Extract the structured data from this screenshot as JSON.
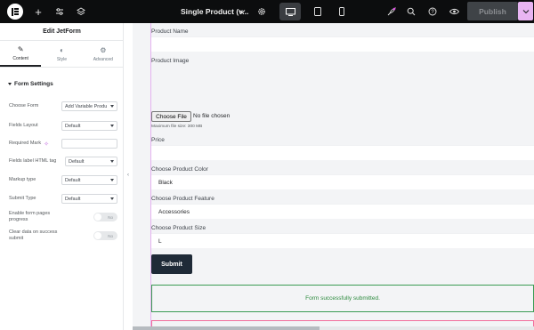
{
  "topbar": {
    "doc_title": "Single Product (v...",
    "publish_label": "Publish",
    "icons": [
      "elementor-logo",
      "plus-icon",
      "sliders-icon",
      "layers-icon",
      "chevron-down-icon",
      "gear-icon",
      "desktop-icon",
      "tablet-icon",
      "mobile-icon",
      "rocket-icon",
      "search-icon",
      "help-icon",
      "eye-icon",
      "chevron-down-icon"
    ]
  },
  "panel": {
    "title": "Edit JetForm",
    "tabs": [
      {
        "label": "Content",
        "icon": "pencil-icon",
        "active": true
      },
      {
        "label": "Style",
        "icon": "contrast-icon",
        "active": false
      },
      {
        "label": "Advanced",
        "icon": "gear-icon",
        "active": false
      }
    ],
    "section_title": "Form Settings",
    "controls": [
      {
        "label": "Choose Form",
        "value": "Add Variable Produ"
      },
      {
        "label": "Fields Layout",
        "value": "Default"
      },
      {
        "label": "Required Mark",
        "value": ""
      },
      {
        "label": "Fields label HTML tag",
        "value": "Default"
      },
      {
        "label": "Markup type",
        "value": "Default"
      },
      {
        "label": "Submit Type",
        "value": "Default"
      }
    ],
    "toggles": [
      {
        "label": "Enable form pages progress",
        "state": "No"
      },
      {
        "label": "Clear data on success submit",
        "state": "No"
      }
    ]
  },
  "form": {
    "product_name_label": "Product Name",
    "product_image_label": "Product Image",
    "choose_file_label": "Choose File",
    "no_file_text": "No file chosen",
    "max_file_note": "Maximum file size: 300 MB",
    "price_label": "Price",
    "color_label": "Choose Product Color",
    "color_value": "Black",
    "feature_label": "Choose Product Feature",
    "feature_value": "Accessories",
    "size_label": "Choose Product Size",
    "size_value": "L",
    "submit_label": "Submit",
    "success_message": "Form successfully submitted."
  },
  "colors": {
    "topbar_bg": "#0c0d0e",
    "accent_pink": "#e8b5f2",
    "submit_bg": "#1f2a37",
    "success_border": "#3a9b53",
    "error_border": "#f26c9b"
  }
}
